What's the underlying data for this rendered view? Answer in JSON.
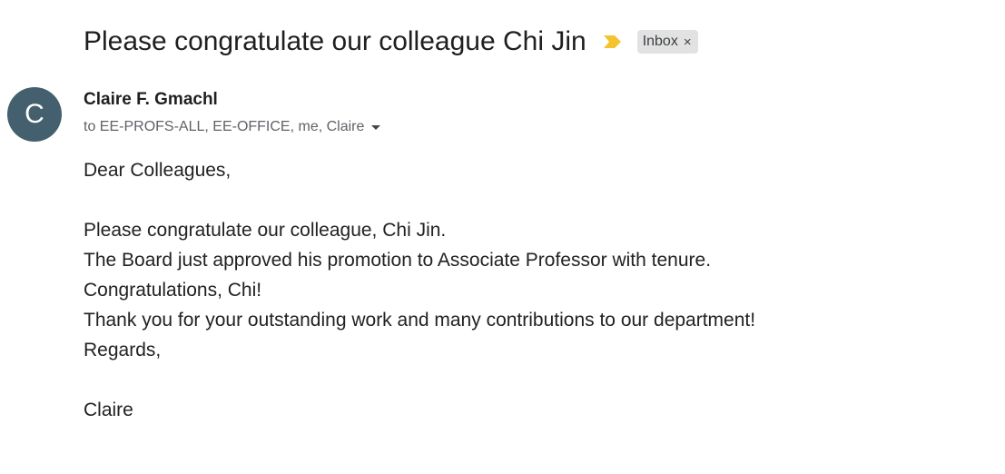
{
  "email": {
    "subject": "Please congratulate our colleague Chi Jin",
    "importance_icon": "importance-marker-icon",
    "importance_color": "#f4c430",
    "label": {
      "text": "Inbox",
      "close": "×"
    }
  },
  "sender": {
    "avatar_letter": "C",
    "avatar_color": "#44606e",
    "name": "Claire F. Gmachl",
    "recipients": "to EE-PROFS-ALL, EE-OFFICE, me, Claire"
  },
  "body": {
    "greeting": "Dear Colleagues,",
    "lines": [
      "Please congratulate our colleague, Chi Jin.",
      "The Board just approved his promotion to Associate Professor with tenure.",
      "Congratulations, Chi!",
      "Thank you for your outstanding work and many contributions to our department!",
      "Regards,"
    ],
    "signature": "Claire"
  }
}
